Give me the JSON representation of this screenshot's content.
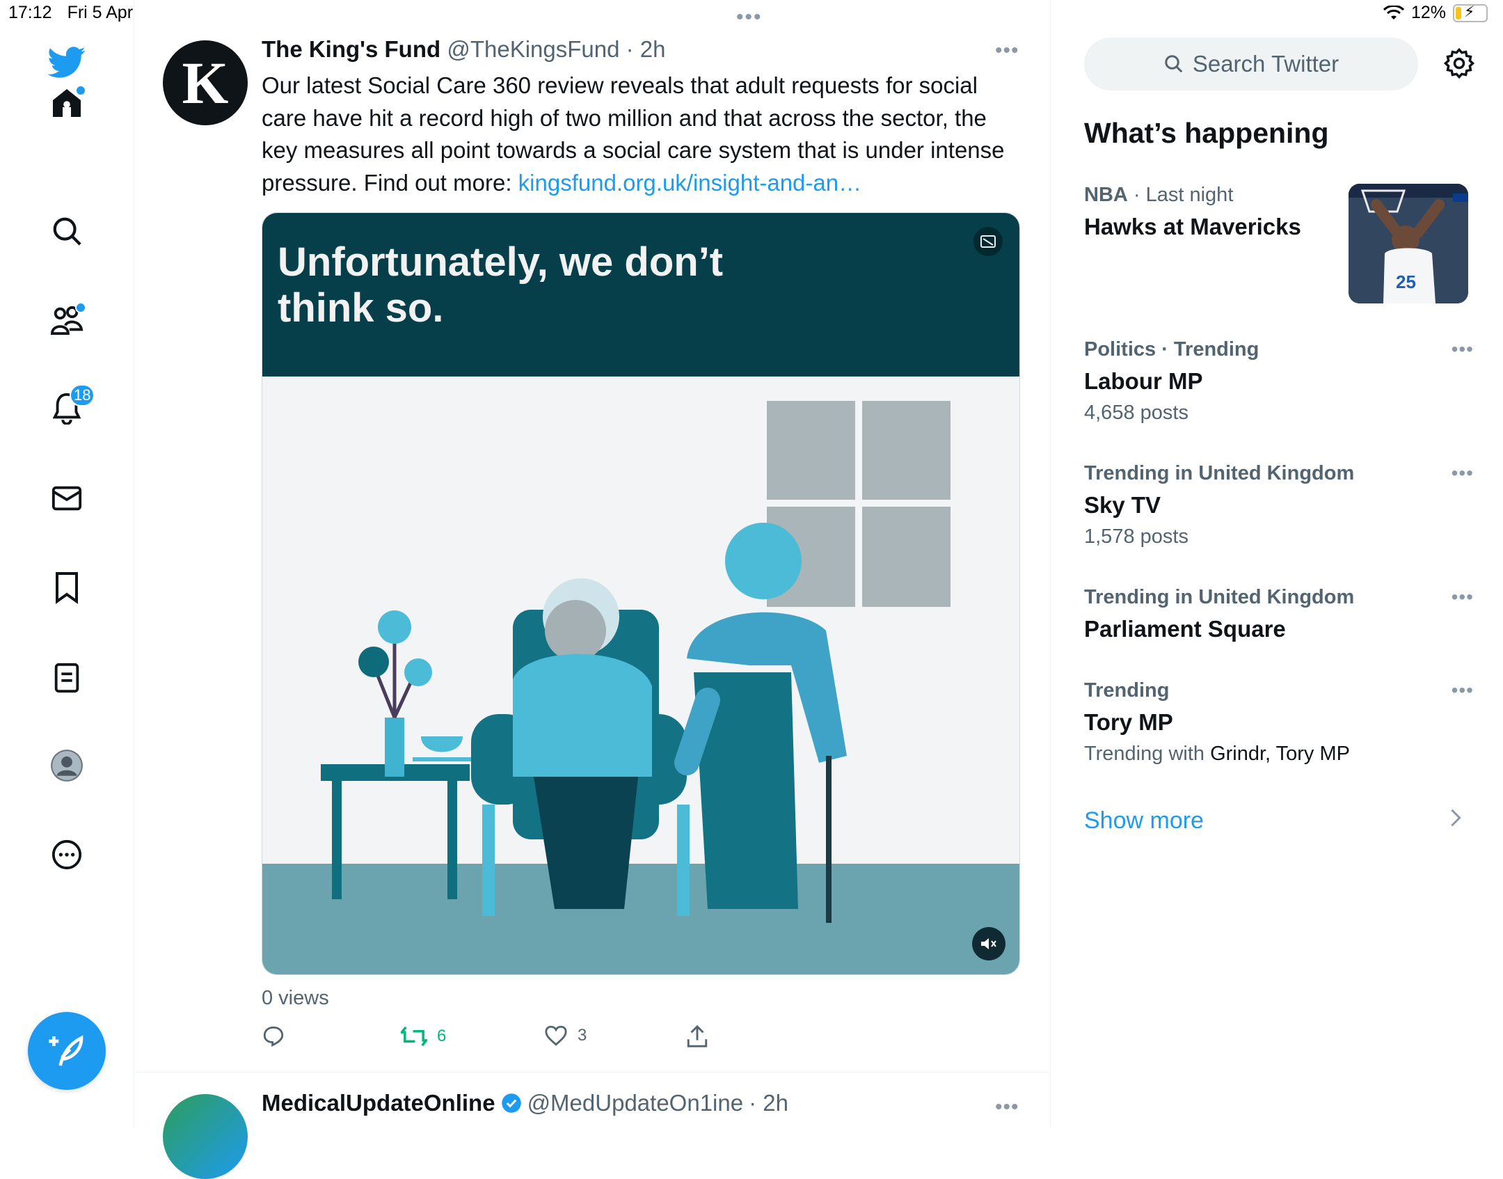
{
  "status_bar": {
    "time": "17:12",
    "date": "Fri 5 Apr",
    "battery": "12%"
  },
  "nav": {
    "items": [
      {
        "name": "twitter-bird-icon"
      },
      {
        "name": "home-icon"
      },
      {
        "name": "search-icon"
      },
      {
        "name": "communities-icon"
      },
      {
        "name": "notifications-icon"
      },
      {
        "name": "messages-icon"
      },
      {
        "name": "bookmarks-icon"
      },
      {
        "name": "lists-icon"
      },
      {
        "name": "profile-icon"
      },
      {
        "name": "more-icon"
      }
    ],
    "notifications_badge": "18"
  },
  "grabber": "•••",
  "tweet1": {
    "name": "The King's Fund",
    "handle": "@TheKingsFund",
    "time": "· 2h",
    "more": "•••",
    "avatar_letter": "K",
    "text_body": "Our latest Social Care 360 review reveals that adult requests for social care have hit a record high of two million and that across the sector, the key measures all point towards a social care system that is under intense pressure. Find out more: ",
    "link": "kingsfund.org.uk/insight-and-an…",
    "media_caption_line1": "Unfortunately, we don’t",
    "media_caption_line2": "think so.",
    "views": "0 views",
    "retweets": "6",
    "likes": "3"
  },
  "tweet2": {
    "name": "MedicalUpdateOnline",
    "handle": "@MedUpdateOn1ine",
    "time": "· 2h",
    "more": "•••"
  },
  "sidebar": {
    "search_placeholder": "Search Twitter",
    "heading": "What’s happening",
    "trends": [
      {
        "category": "NBA",
        "category_meta": " · Last night",
        "title": "Hawks at Mavericks",
        "sub": ""
      },
      {
        "category": "Politics · Trending",
        "category_meta": "",
        "title": "Labour MP",
        "sub": "4,658 posts"
      },
      {
        "category": "Trending in United Kingdom",
        "category_meta": "",
        "title": "Sky TV",
        "sub": "1,578 posts"
      },
      {
        "category": "Trending in United Kingdom",
        "category_meta": "",
        "title": "Parliament Square",
        "sub": ""
      },
      {
        "category": "Trending",
        "category_meta": "",
        "title": "Tory MP",
        "sub_prefix": "Trending with ",
        "sub_dark": "Grindr, Tory MP"
      }
    ],
    "show_more": "Show more"
  },
  "colors": {
    "accent": "#1d9bf0",
    "retweet_green": "#00ba7c",
    "media_dark": "#063f4a"
  }
}
